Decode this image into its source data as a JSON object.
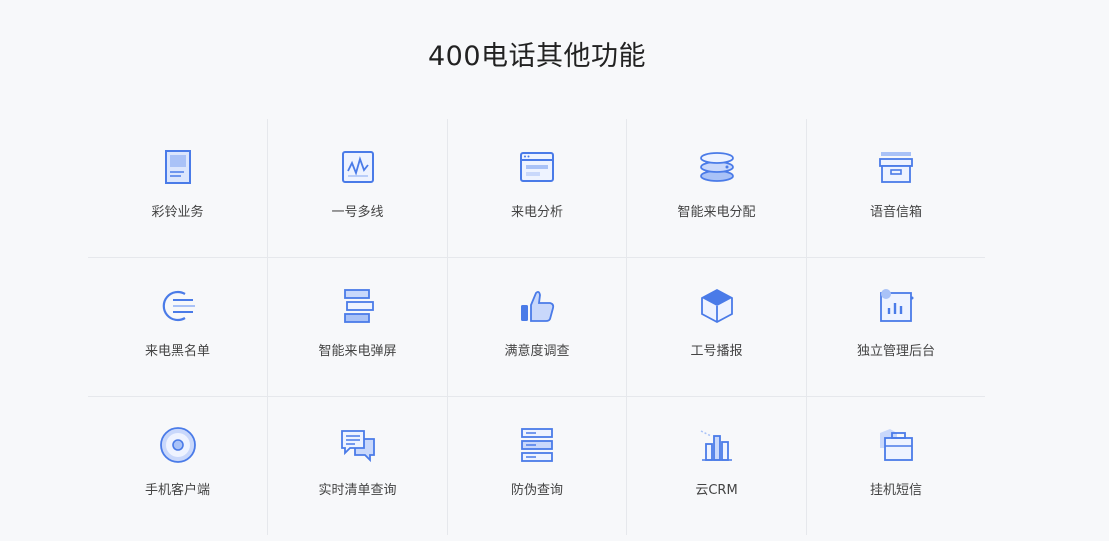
{
  "page": {
    "title": "400电话其他功能"
  },
  "features": [
    {
      "label": "彩铃业务",
      "icon": "document-icon"
    },
    {
      "label": "一号多线",
      "icon": "line-chart-icon"
    },
    {
      "label": "来电分析",
      "icon": "browser-window-icon"
    },
    {
      "label": "智能来电分配",
      "icon": "layers-icon"
    },
    {
      "label": "语音信箱",
      "icon": "archive-box-icon"
    },
    {
      "label": "来电黑名单",
      "icon": "block-list-icon"
    },
    {
      "label": "智能来电弹屏",
      "icon": "stacked-bars-icon"
    },
    {
      "label": "满意度调查",
      "icon": "thumbs-up-icon"
    },
    {
      "label": "工号播报",
      "icon": "cube-icon"
    },
    {
      "label": "独立管理后台",
      "icon": "dashboard-chart-icon"
    },
    {
      "label": "手机客户端",
      "icon": "disc-icon"
    },
    {
      "label": "实时清单查询",
      "icon": "chat-bubbles-icon"
    },
    {
      "label": "防伪查询",
      "icon": "server-stack-icon"
    },
    {
      "label": "云CRM",
      "icon": "bar-chart-icon"
    },
    {
      "label": "挂机短信",
      "icon": "folder-icon"
    }
  ],
  "colors": {
    "icon_primary": "#4a7be8",
    "icon_light": "#c9d8fb",
    "background": "#f7f8fa",
    "divider": "#e6e8ec"
  }
}
